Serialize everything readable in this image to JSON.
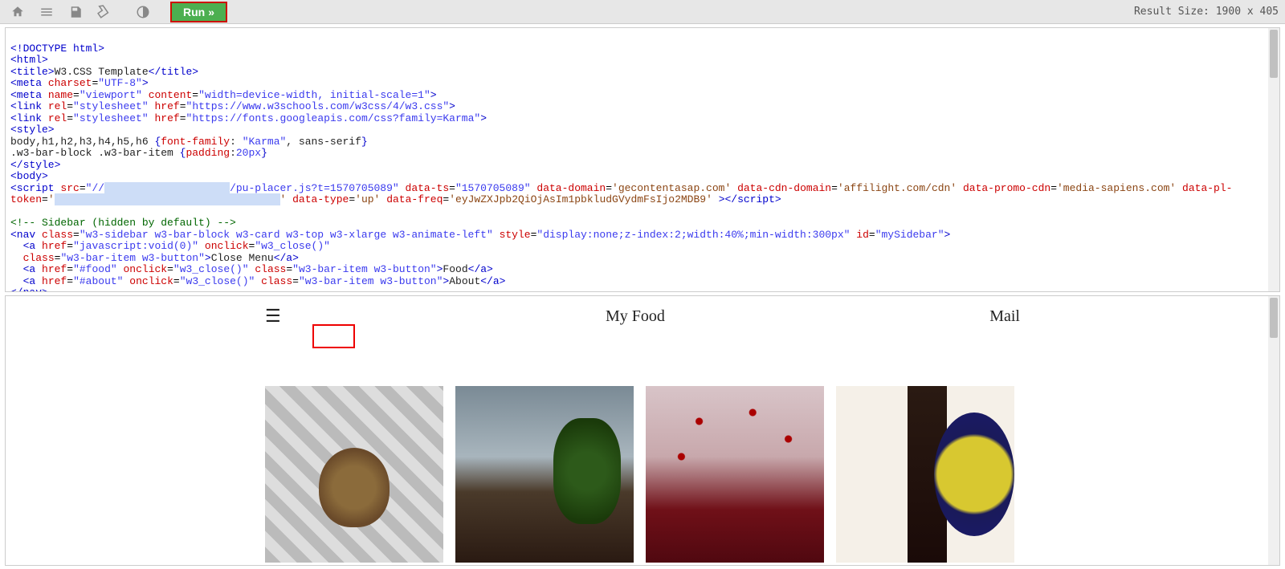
{
  "toolbar": {
    "run_label": "Run",
    "result_size_label": "Result Size:",
    "result_size_value": "1900 x 405"
  },
  "code": {
    "l1": "<!DOCTYPE html>",
    "l2": "<html>",
    "l3_open": "<title>",
    "l3_text": "W3.CSS Template",
    "l3_close": "</title>",
    "l4": "<meta charset=\"UTF-8\">",
    "l5": "<meta name=\"viewport\" content=\"width=device-width, initial-scale=1\">",
    "l6": "<link rel=\"stylesheet\" href=\"https://www.w3schools.com/w3css/4/w3.css\">",
    "l7": "<link rel=\"stylesheet\" href=\"https://fonts.googleapis.com/css?family=Karma\">",
    "l8": "<style>",
    "l9": "body,h1,h2,h3,h4,h5,h6 {font-family: \"Karma\", sans-serif}",
    "l10": ".w3-bar-block .w3-bar-item {padding:20px}",
    "l11": "</style>",
    "l12": "<body>",
    "l13a": "<script src=\"//",
    "l13b": "/pu-placer.js?t=1570705089\" data-ts=\"1570705089\" data-domain='gecontentasap.com' data-cdn-domain='affilight.com/cdn' data-promo-cdn='media-sapiens.com' data-pl-",
    "l14a": "token='",
    "l14b": "' data-type='up' data-freq='eyJwZXJpb2QiOjAsIm1pbkludGVydmFsIjo2MDB9' ></script>",
    "l15": "",
    "l16": "<!-- Sidebar (hidden by default) -->",
    "l17": "<nav class=\"w3-sidebar w3-bar-block w3-card w3-top w3-xlarge w3-animate-left\" style=\"display:none;z-index:2;width:40%;min-width:300px\" id=\"mySidebar\">",
    "l18": "  <a href=\"javascript:void(0)\" onclick=\"w3_close()\"",
    "l19a": "  class=\"w3-bar-item w3-button\">",
    "l19_text": "Close Menu",
    "l19b": "</a>",
    "l20a": "  <a href=\"#food\" onclick=\"w3_close()\" class=\"w3-bar-item w3-button\">",
    "l20_text": "Food",
    "l20b": "</a>",
    "l21a": "  <a href=\"#about\" onclick=\"w3_close()\" class=\"w3-bar-item w3-button\">",
    "l21_text": "About",
    "l21b": "</a>",
    "l22": "</nav>",
    "redacted1": "                    ",
    "redacted2": "                                    "
  },
  "preview": {
    "title": "My Food",
    "mail": "Mail",
    "hamburger": "☰"
  }
}
